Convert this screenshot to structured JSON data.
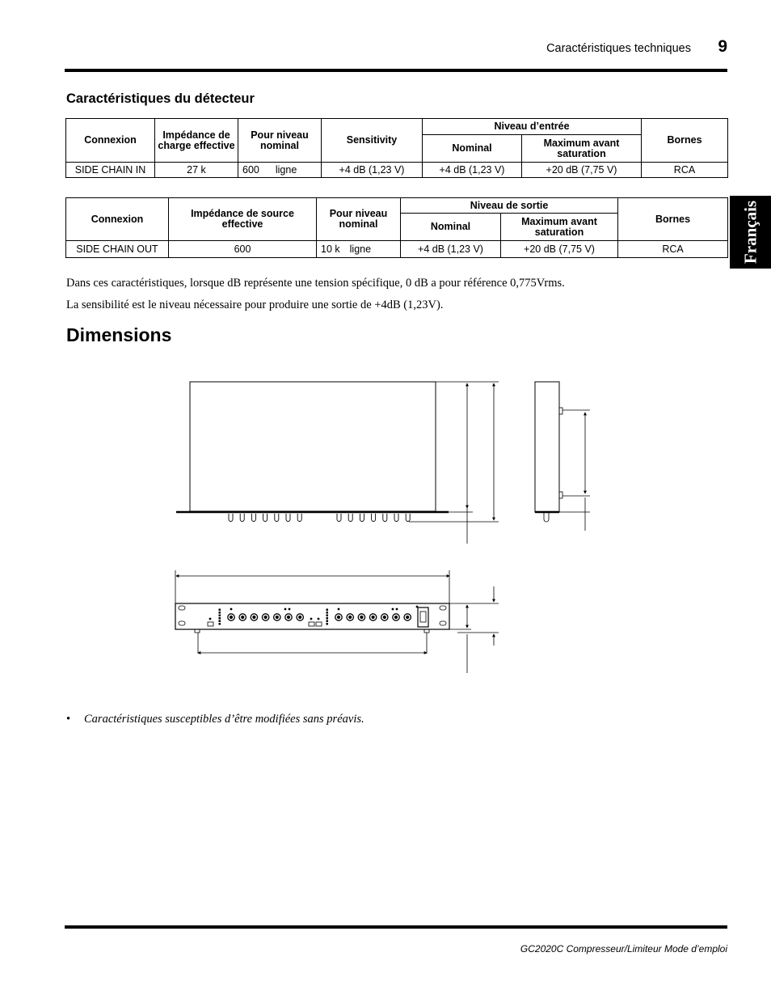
{
  "header": {
    "title": "Caractéristiques techniques",
    "page_number": "9"
  },
  "language_tab": "Français",
  "detector_section": {
    "heading": "Caractéristiques du détecteur",
    "input_table": {
      "headers": {
        "connexion": "Connexion",
        "impedance": "Impédance de charge effective",
        "pour_niveau": "Pour niveau nominal",
        "sensitivity": "Sensitivity",
        "group": "Niveau d’entrée",
        "nominal": "Nominal",
        "maximum": "Maximum avant saturation",
        "bornes": "Bornes"
      },
      "rows": [
        {
          "connexion": "SIDE CHAIN IN",
          "impedance": "27 k",
          "pour_niveau_value": "600",
          "pour_niveau_unit": "ligne",
          "sensitivity": "+4 dB (1,23 V)",
          "nominal": "+4 dB (1,23 V)",
          "maximum": "+20 dB (7,75 V)",
          "bornes": "RCA"
        }
      ]
    },
    "output_table": {
      "headers": {
        "connexion": "Connexion",
        "impedance": "Impédance de source effective",
        "pour_niveau": "Pour niveau nominal",
        "group": "Niveau de sortie",
        "nominal": "Nominal",
        "maximum": "Maximum avant saturation",
        "bornes": "Bornes"
      },
      "rows": [
        {
          "connexion": "SIDE CHAIN OUT",
          "impedance": "600",
          "pour_niveau_value": "10 k",
          "pour_niveau_unit": "ligne",
          "nominal": "+4 dB (1,23 V)",
          "maximum": "+20 dB (7,75 V)",
          "bornes": "RCA"
        }
      ]
    },
    "notes": [
      "Dans ces caractéristiques, lorsque dB représente une tension spécifique, 0 dB a pour référence 0,775Vrms.",
      "La sensibilité est le niveau nécessaire pour produire une sortie de +4dB (1,23V)."
    ]
  },
  "dimensions_section": {
    "heading": "Dimensions",
    "drawing_label": "dimensions-drawing",
    "front_panel_knobs_per_channel": 7,
    "channels": 2
  },
  "disclaimer": {
    "bullet": "•",
    "text": "Caractéristiques susceptibles d’être modifiées sans préavis."
  },
  "footer": "GC2020C Compresseur/Limiteur Mode d’emploi"
}
